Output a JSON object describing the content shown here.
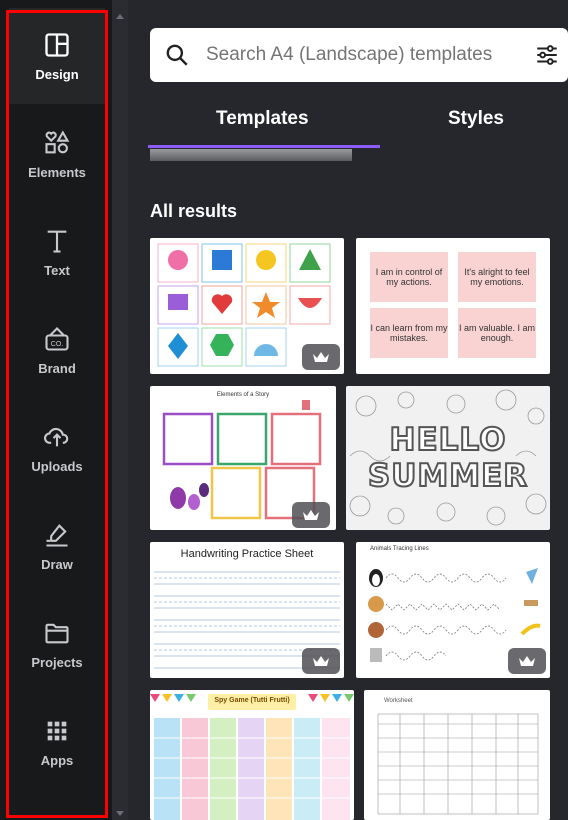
{
  "nav": [
    {
      "label": "Design",
      "icon": "layout-icon",
      "active": true
    },
    {
      "label": "Elements",
      "icon": "shapes-icon"
    },
    {
      "label": "Text",
      "icon": "text-icon"
    },
    {
      "label": "Brand",
      "icon": "brand-icon"
    },
    {
      "label": "Uploads",
      "icon": "cloud-upload-icon"
    },
    {
      "label": "Draw",
      "icon": "draw-icon"
    },
    {
      "label": "Projects",
      "icon": "folder-icon"
    },
    {
      "label": "Apps",
      "icon": "apps-grid-icon"
    }
  ],
  "search": {
    "placeholder": "Search A4 (Landscape) templates"
  },
  "tabs": {
    "templates": "Templates",
    "styles": "Styles"
  },
  "section_title": "All results",
  "templates": [
    {
      "id": "shapes",
      "label": ""
    },
    {
      "id": "affirmations",
      "lines": [
        "I am in control of my actions.",
        "It's alright to feel my emotions.",
        "I can learn from my mistakes.",
        "I am valuable. I am enough."
      ]
    },
    {
      "id": "elements",
      "title": "Elements of a Story"
    },
    {
      "id": "hello-summer",
      "title": "HELLO SUMMER"
    },
    {
      "id": "handwriting",
      "title": "Handwriting Practice Sheet"
    },
    {
      "id": "tracing",
      "title": "Animals Tracing Lines"
    },
    {
      "id": "spy-game",
      "title": "Spy Game (Tutti Frutti)"
    },
    {
      "id": "worksheet",
      "title": "Worksheet"
    }
  ],
  "colors": {
    "accent": "#8b5cf6",
    "outline": "#ff0000"
  }
}
